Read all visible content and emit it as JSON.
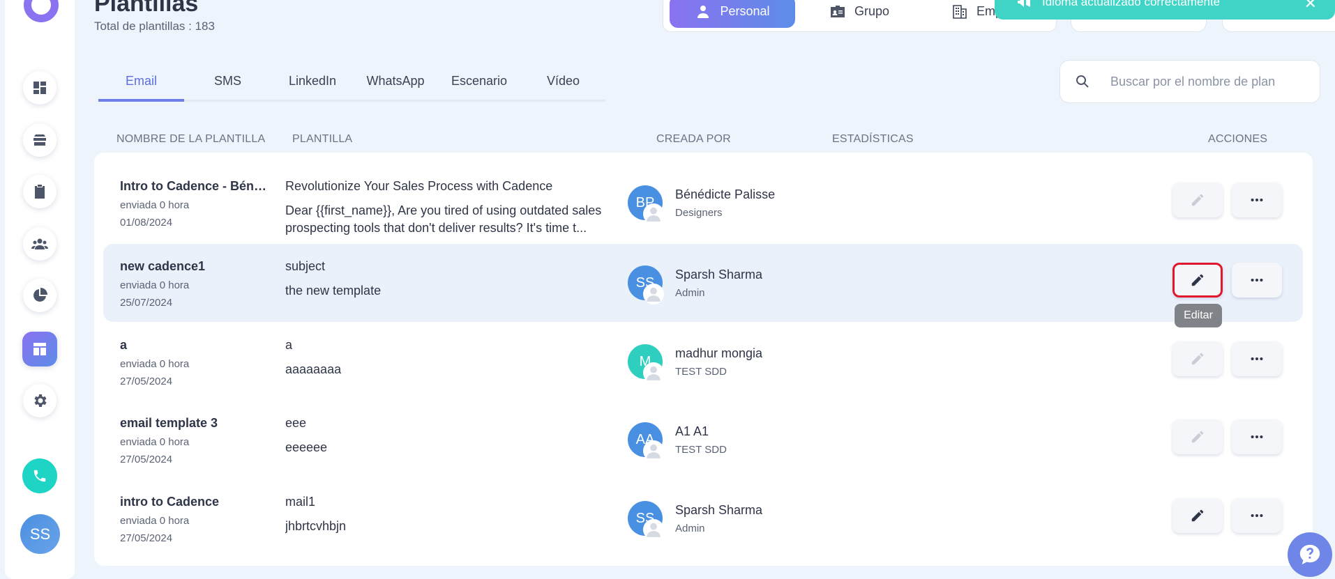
{
  "header": {
    "title": "Plantillas",
    "count_text": "Total de plantillas : 183"
  },
  "scope": {
    "personal": "Personal",
    "group": "Grupo",
    "company": "Emp"
  },
  "toast": {
    "message": "Idioma actualizado correctamente"
  },
  "tabs": [
    {
      "label": "Email"
    },
    {
      "label": "SMS"
    },
    {
      "label": "LinkedIn"
    },
    {
      "label": "WhatsApp"
    },
    {
      "label": "Escenario"
    },
    {
      "label": "Vídeo"
    }
  ],
  "search": {
    "placeholder": "Buscar por el nombre de plan"
  },
  "columns": {
    "name": "NOMBRE DE LA PLANTILLA",
    "template": "PLANTILLA",
    "created_by": "CREADA POR",
    "stats": "ESTADÍSTICAS",
    "actions": "ACCIONES"
  },
  "rows": [
    {
      "name": "Intro to Cadence - Bénédicte",
      "meta": "enviada 0 hora",
      "date": "01/08/2024",
      "subject": "Revolutionize Your Sales Process with Cadence",
      "body": "Dear {{first_name}},   Are you tired of using outdated sales prospecting tools that don't deliver results? It's time t...",
      "initials": "BP",
      "avatar_color": "#4a90e2",
      "creator": "Bénédicte Palisse",
      "team": "Designers"
    },
    {
      "name": "new cadence1",
      "meta": "enviada 0 hora",
      "date": "25/07/2024",
      "subject": "subject",
      "body": "the new template",
      "initials": "SS",
      "avatar_color": "#4a90e2",
      "creator": "Sparsh Sharma",
      "team": "Admin"
    },
    {
      "name": "a",
      "meta": "enviada 0 hora",
      "date": "27/05/2024",
      "subject": "a",
      "body": "aaaaaaaa",
      "initials": "M",
      "avatar_color": "#2fcfc0",
      "creator": "madhur mongia",
      "team": "TEST SDD"
    },
    {
      "name": "email template 3",
      "meta": "enviada 0 hora",
      "date": "27/05/2024",
      "subject": "eee",
      "body": "eeeeee",
      "initials": "AA",
      "avatar_color": "#4a90e2",
      "creator": "A1 A1",
      "team": "TEST SDD"
    },
    {
      "name": "intro to Cadence",
      "meta": "enviada 0 hora",
      "date": "27/05/2024",
      "subject": "mail1",
      "body": "jhbrtcvhbjn",
      "initials": "SS",
      "avatar_color": "#4a90e2",
      "creator": "Sparsh Sharma",
      "team": "Admin"
    }
  ],
  "tooltip": "Editar",
  "user": {
    "initials": "SS"
  }
}
